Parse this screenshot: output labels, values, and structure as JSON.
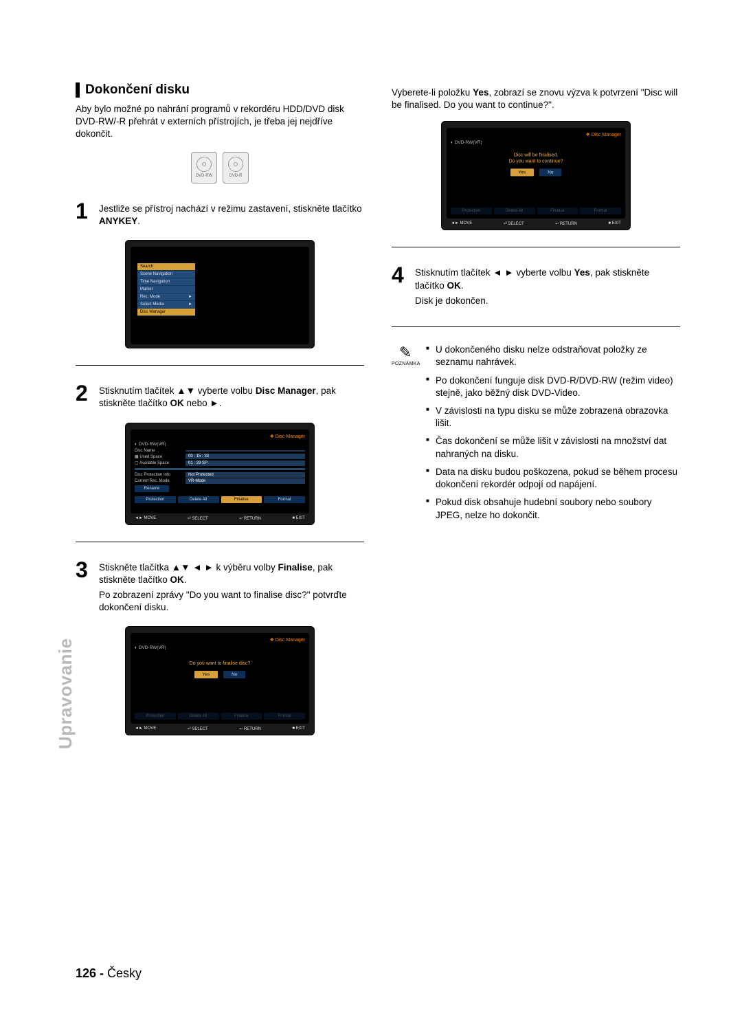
{
  "sideLabel": "Upravovanie",
  "pageNumber": "126 -",
  "pageLang": "Česky",
  "heading": "Dokončení disku",
  "intro": "Aby bylo možné po nahrání programů v rekordéru HDD/DVD disk DVD-RW/-R přehrát v externích přístrojích, je třeba jej nejdříve dokončit.",
  "discIcons": [
    "DVD-RW",
    "DVD-R"
  ],
  "steps": {
    "s1": {
      "num": "1",
      "p": "Jestliže se přístroj nachází v režimu zastavení, stiskněte tlačítko ",
      "btn": "ANYKEY",
      "suffix": "."
    },
    "s2": {
      "num": "2",
      "p": "Stisknutím tlačítek ▲▼ vyberte volbu ",
      "bold": "Disc Manager",
      "p2": ", pak stiskněte tlačítko ",
      "bold2": "OK",
      "p3": " nebo ►."
    },
    "s3": {
      "num": "3",
      "p": "Stiskněte tlačítka ▲▼ ◄ ► k výběru volby ",
      "bold": "Finalise",
      "p2": ", pak stiskněte tlačítko ",
      "bold2": "OK",
      "p3": ".",
      "extra": "Po zobrazení zprávy \"Do you want to finalise disc?\" potvrďte dokončení disku."
    },
    "s4": {
      "num": "4",
      "pre": "Vyberete-li položku ",
      "bold0": "Yes",
      "mid": ", zobrazí se znovu výzva k potvrzení \"Disc will be finalised. Do you want to continue?\".",
      "p": "Stisknutím tlačítek ◄ ► vyberte volbu ",
      "bold": "Yes",
      "p2": ", pak stiskněte tlačítko ",
      "bold2": "OK",
      "p3": ".",
      "extra": "Disk je dokončen."
    }
  },
  "menu": {
    "items": [
      "Search",
      "Scene Navigation",
      "Time Navigation",
      "Marker",
      "Rec. Mode",
      "Select Media",
      "Disc Manager"
    ],
    "arrows": {
      "4": "►",
      "5": "►"
    },
    "selected": 6
  },
  "screen2": {
    "headerIcon": "❖",
    "headerTitle": "Disc Manager",
    "breadcrumb": "DVD-RW(VR)",
    "discNameLabel": "Disc Name",
    "rows": [
      {
        "label": "Used Space",
        "val": "00 : 15 : 33"
      },
      {
        "label": "Available Space",
        "val": "01 : 29 SP"
      }
    ],
    "rows2": [
      {
        "label": "Disc Protection Info",
        "val": "Not Protected"
      },
      {
        "label": "Current Rec. Mode",
        "val": "VR-Mode"
      }
    ],
    "rename": "Rename",
    "btns": [
      "Protection",
      "Delete All",
      "Finalise",
      "Format"
    ],
    "foot": [
      "MOVE",
      "SELECT",
      "RETURN",
      "EXIT"
    ],
    "footIcons": [
      "◄►",
      "⏎",
      "↩",
      "■"
    ]
  },
  "screen3": {
    "headerTitle": "Disc Manager",
    "breadcrumb": "DVD-RW(VR)",
    "msg": "Do you want to finalise disc?",
    "yes": "Yes",
    "no": "No",
    "btns": [
      "Protection",
      "Delete All",
      "Finalise",
      "Format"
    ],
    "foot": [
      "MOVE",
      "SELECT",
      "RETURN",
      "EXIT"
    ]
  },
  "screen4": {
    "headerTitle": "Disc Manager",
    "breadcrumb": "DVD-RW(VR)",
    "msg1": "Disc will be finalised.",
    "msg2": "Do you want to continue?",
    "yes": "Yes",
    "no": "No",
    "btns": [
      "Protection",
      "Delete All",
      "Finalise",
      "Format"
    ],
    "foot": [
      "MOVE",
      "SELECT",
      "RETURN",
      "EXIT"
    ]
  },
  "note": {
    "label": "POZNÁMKA",
    "items": [
      "U dokončeného disku nelze odstraňovat položky ze seznamu nahrávek.",
      "Po dokončení funguje disk DVD-R/DVD-RW (režim video) stejně, jako běžný disk DVD-Video.",
      "V závislosti na typu disku se může zobrazená obrazovka lišit.",
      "Čas dokončení se může lišit v závislosti na množství dat nahraných na disku.",
      "Data na disku budou poškozena, pokud se během procesu dokončení rekordér odpojí od napájení.",
      "Pokud disk obsahuje hudební soubory nebo soubory JPEG, nelze ho dokončit."
    ]
  }
}
